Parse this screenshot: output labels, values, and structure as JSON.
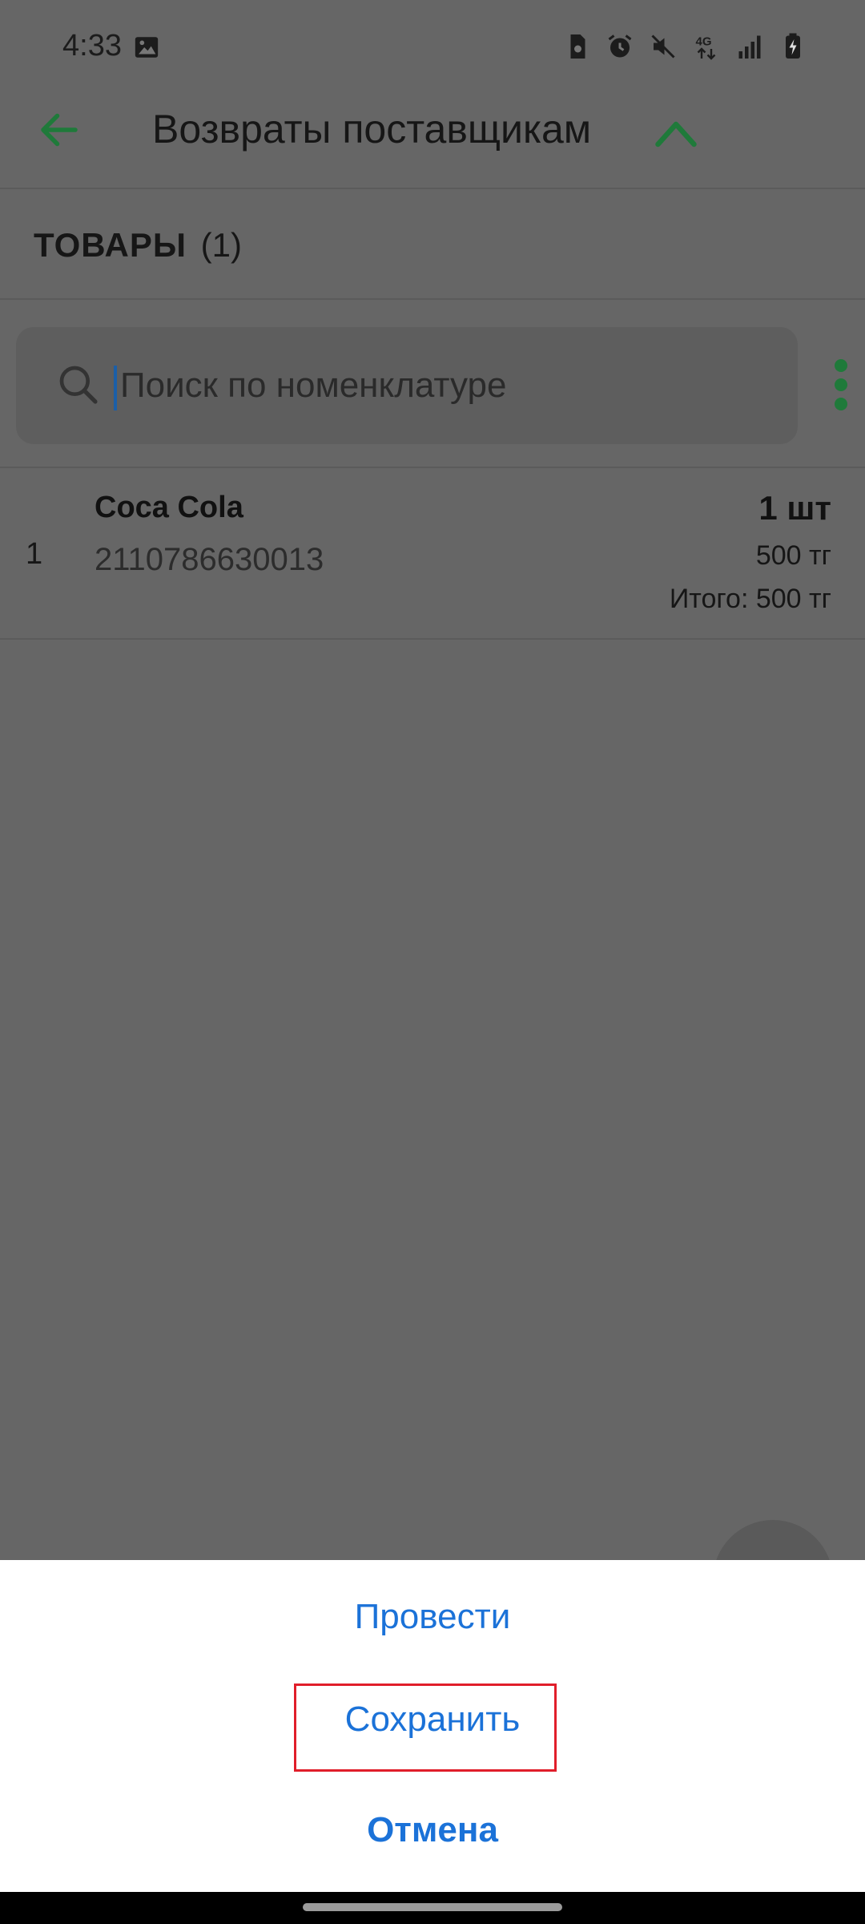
{
  "status_bar": {
    "time": "4:33",
    "icons": [
      "image-icon",
      "sim-icon",
      "alarm-icon",
      "mute-icon",
      "network-4g-icon",
      "signal-icon",
      "battery-charging-icon"
    ]
  },
  "app_bar": {
    "title": "Возвраты поставщикам",
    "accent_color": "#1f7a3a"
  },
  "section": {
    "name": "ТОВАРЫ",
    "count": "(1)"
  },
  "search": {
    "placeholder": "Поиск по номенклатуре",
    "value": ""
  },
  "items": [
    {
      "index": "1",
      "name": "Coca Cola",
      "barcode": "2110786630013",
      "quantity": "1 шт",
      "price": "500 тг",
      "total": "Итого: 500 тг"
    }
  ],
  "sheet": {
    "conduct_label": "Провести",
    "save_label": "Сохранить",
    "cancel_label": "Отмена",
    "button_color": "#1b72d8",
    "highlight_color": "#e01e2a"
  }
}
